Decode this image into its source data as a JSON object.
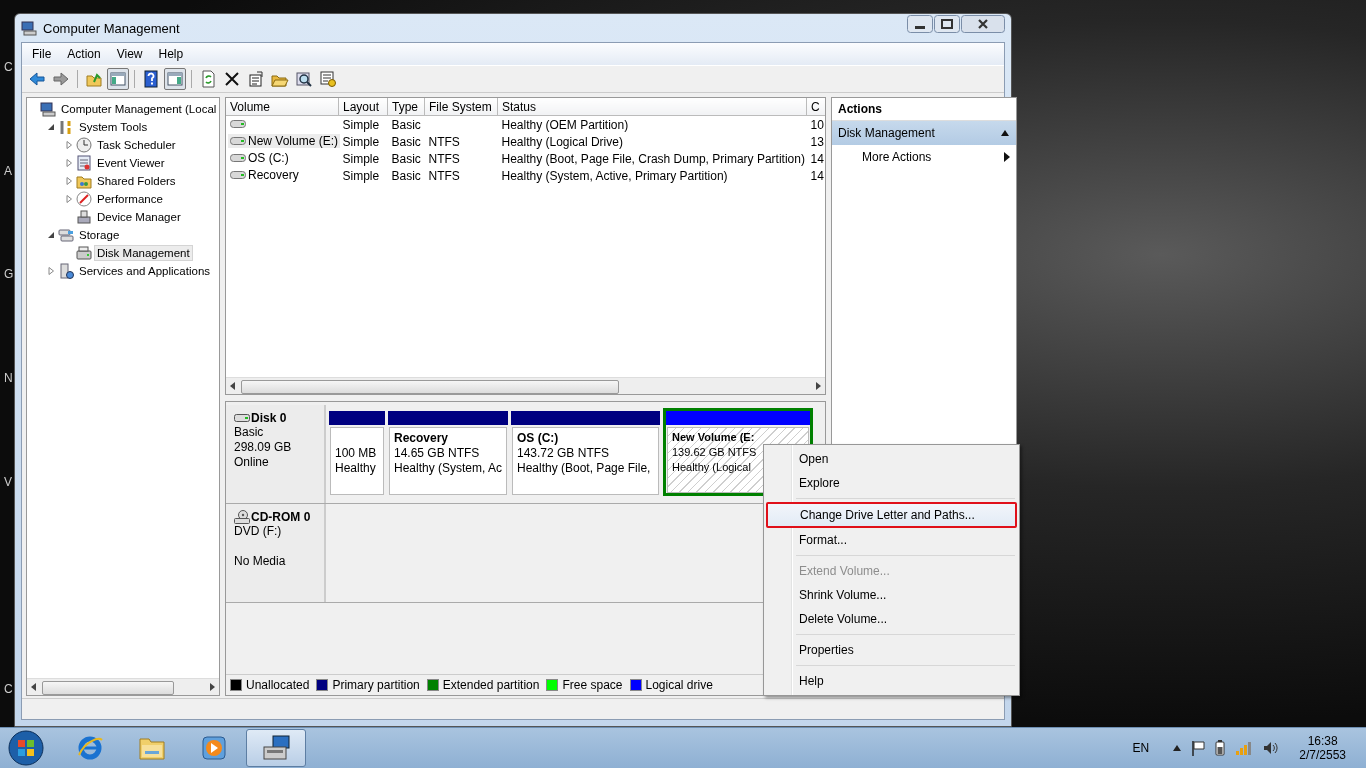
{
  "desktop_labels": [
    "C",
    "A",
    "G",
    "N",
    "V",
    "C"
  ],
  "window": {
    "title": "Computer Management"
  },
  "menu": [
    "File",
    "Action",
    "View",
    "Help"
  ],
  "toolbar": [
    {
      "pressed": false
    },
    {
      "pressed": false
    },
    {
      "pressed": false
    },
    {
      "pressed": true
    },
    {
      "pressed": false
    },
    {
      "pressed": true
    },
    {
      "pressed": false
    },
    {
      "pressed": false
    },
    {
      "pressed": false
    },
    {
      "pressed": false
    },
    {
      "pressed": false
    },
    {
      "pressed": false
    }
  ],
  "tree": [
    {
      "label": "Computer Management (Local",
      "selected": false,
      "children": [
        {
          "label": "System Tools",
          "expanded": true,
          "selected": false,
          "children": [
            {
              "label": "Task Scheduler",
              "expanded": false,
              "selected": false
            },
            {
              "label": "Event Viewer",
              "expanded": false,
              "selected": false
            },
            {
              "label": "Shared Folders",
              "expanded": false,
              "selected": false
            },
            {
              "label": "Performance",
              "expanded": false,
              "selected": false
            },
            {
              "label": "Device Manager",
              "selected": false
            }
          ]
        },
        {
          "label": "Storage",
          "expanded": true,
          "selected": false,
          "children": [
            {
              "label": "Disk Management",
              "selected": true
            }
          ]
        },
        {
          "label": "Services and Applications",
          "expanded": false,
          "selected": false
        }
      ]
    }
  ],
  "table": {
    "columns": [
      "Volume",
      "Layout",
      "Type",
      "File System",
      "Status",
      "C"
    ],
    "rows": [
      {
        "layout": "Simple",
        "type": "Basic",
        "status": "Healthy (OEM Partition)",
        "column_6": "10",
        "selected": false
      },
      {
        "volume": "New Volume (E:)",
        "layout": "Simple",
        "type": "Basic",
        "file_system": "NTFS",
        "status": "Healthy (Logical Drive)",
        "column_6": "13",
        "selected": true
      },
      {
        "volume": "OS (C:)",
        "layout": "Simple",
        "type": "Basic",
        "file_system": "NTFS",
        "status": "Healthy (Boot, Page File, Crash Dump, Primary Partition)",
        "column_6": "14",
        "selected": false
      },
      {
        "volume": "Recovery",
        "layout": "Simple",
        "type": "Basic",
        "file_system": "NTFS",
        "status": "Healthy (System, Active, Primary Partition)",
        "column_6": "14",
        "selected": false
      }
    ]
  },
  "disks": [
    {
      "kind": "disk",
      "name": "Disk 0",
      "type": "Basic",
      "size": "298.09 GB",
      "state": "Online",
      "partitions": [
        {
          "kind": "primary",
          "selected": false,
          "size": "100 MB",
          "status": "Healthy"
        },
        {
          "kind": "primary",
          "selected": false,
          "name": "Recovery",
          "size": "14.65 GB NTFS",
          "status": "Healthy (System, Ac"
        },
        {
          "kind": "primary",
          "selected": false,
          "name": "OS  (C:)",
          "size": "143.72 GB NTFS",
          "status": "Healthy (Boot, Page File,"
        },
        {
          "kind": "logical",
          "selected": true,
          "name": "New Volume  (E:",
          "size": "139.62 GB NTFS",
          "status": "Healthy (Logical"
        }
      ]
    },
    {
      "kind": "cdrom",
      "name": "CD-ROM 0",
      "type": "DVD (F:)",
      "state": "No Media"
    }
  ],
  "legend": [
    {
      "label": "Unallocated",
      "color": "#000000"
    },
    {
      "label": "Primary partition",
      "color": "#000080"
    },
    {
      "label": "Extended partition",
      "color": "#008000"
    },
    {
      "label": "Free space",
      "color": "#00ff00"
    },
    {
      "label": "Logical drive",
      "color": "#0000ff"
    }
  ],
  "actions": {
    "header": "Actions",
    "sections": [
      {
        "label": "Disk Management",
        "expanded": true,
        "items": [
          {
            "label": "More Actions"
          }
        ]
      }
    ]
  },
  "context_menu": [
    {
      "kind": "item",
      "label": "Open",
      "disabled": false,
      "selected": false
    },
    {
      "kind": "item",
      "label": "Explore",
      "disabled": false,
      "selected": false
    },
    {
      "kind": "separator"
    },
    {
      "kind": "item",
      "label": "Change Drive Letter and Paths...",
      "disabled": false,
      "selected": true
    },
    {
      "kind": "item",
      "label": "Format...",
      "disabled": false,
      "selected": false
    },
    {
      "kind": "separator"
    },
    {
      "kind": "item",
      "label": "Extend Volume...",
      "disabled": true,
      "selected": false
    },
    {
      "kind": "item",
      "label": "Shrink Volume...",
      "disabled": false,
      "selected": false
    },
    {
      "kind": "item",
      "label": "Delete Volume...",
      "disabled": false,
      "selected": false
    },
    {
      "kind": "separator"
    },
    {
      "kind": "item",
      "label": "Properties",
      "disabled": false,
      "selected": false
    },
    {
      "kind": "separator"
    },
    {
      "kind": "item",
      "label": "Help",
      "disabled": false,
      "selected": false
    }
  ],
  "taskbar": {
    "apps": [
      {
        "active": false
      },
      {
        "active": false
      },
      {
        "active": false
      },
      {
        "active": true
      }
    ],
    "language": "EN",
    "time": "16:38",
    "date": "2/7/2553"
  }
}
